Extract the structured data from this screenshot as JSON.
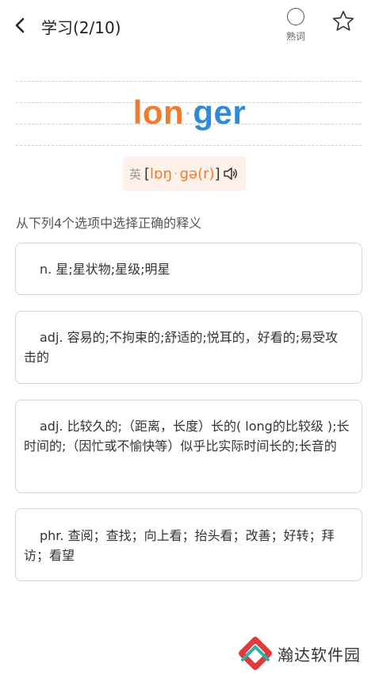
{
  "header": {
    "title": "学习(2/10)",
    "known_label": "熟词"
  },
  "word": {
    "syllable_1": "lon",
    "separator": "·",
    "syllable_2": "ger",
    "colors": {
      "syllable_1": "#f07b2e",
      "syllable_2": "#2f8ad8"
    }
  },
  "phonetic": {
    "lang_label": "英",
    "open": "[",
    "part_1": "lɒŋ",
    "separator": "·",
    "part_2": "gə(r)",
    "close": "]",
    "icon": "speaker-icon"
  },
  "prompt": "从下列4个选项中选择正确的释义",
  "options": [
    {
      "text": "n. 星;星状物;星级;明星"
    },
    {
      "text": "adj. 容易的;不拘束的;舒适的;悦耳的，好看的;易受攻击的"
    },
    {
      "text": "adj. 比较久的;（距离，长度）长的( long的比较级 );长时间的;（因忙或不愉快等）似乎比实际时间长的;长音的"
    },
    {
      "text": "phr. 查阅；查找；向上看；抬头看；改善；好转；拜访；看望"
    }
  ],
  "watermark": {
    "text": "瀚达软件园"
  }
}
